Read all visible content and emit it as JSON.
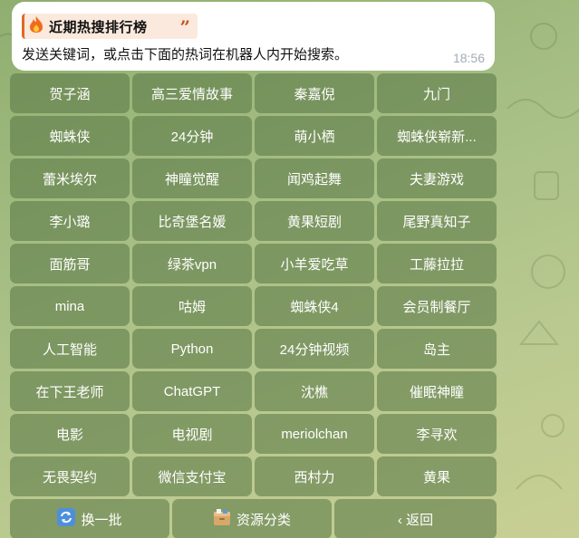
{
  "message": {
    "title_icon": "fire-icon",
    "title": "近期热搜排行榜",
    "text": "发送关键词，或点击下面的热词在机器人内开始搜索。",
    "time": "18:56"
  },
  "keyword_rows": [
    [
      "贺子涵",
      "高三爱情故事",
      "秦嘉倪",
      "九门"
    ],
    [
      "蜘蛛侠",
      "24分钟",
      "萌小栖",
      "蜘蛛侠崭新..."
    ],
    [
      "蕾米埃尔",
      "神瞳觉醒",
      "闻鸡起舞",
      "夫妻游戏"
    ],
    [
      "李小璐",
      "比奇堡名媛",
      "黄果短剧",
      "尾野真知子"
    ],
    [
      "面筋哥",
      "绿茶vpn",
      "小羊爱吃草",
      "工藤拉拉"
    ],
    [
      "mina",
      "咕姆",
      "蜘蛛侠4",
      "会员制餐厅"
    ],
    [
      "人工智能",
      "Python",
      "24分钟视频",
      "岛主"
    ],
    [
      "在下王老师",
      "ChatGPT",
      "沈樵",
      "催眠神瞳"
    ],
    [
      "电影",
      "电视剧",
      "meriolchan",
      "李寻欢"
    ],
    [
      "无畏契约",
      "微信支付宝",
      "西村力",
      "黄果"
    ]
  ],
  "nav": {
    "refresh_label": "换一批",
    "refresh_icon": "refresh-arrows-icon",
    "category_label": "资源分类",
    "category_icon": "card-file-box-icon",
    "back_label": "‹ 返回"
  }
}
